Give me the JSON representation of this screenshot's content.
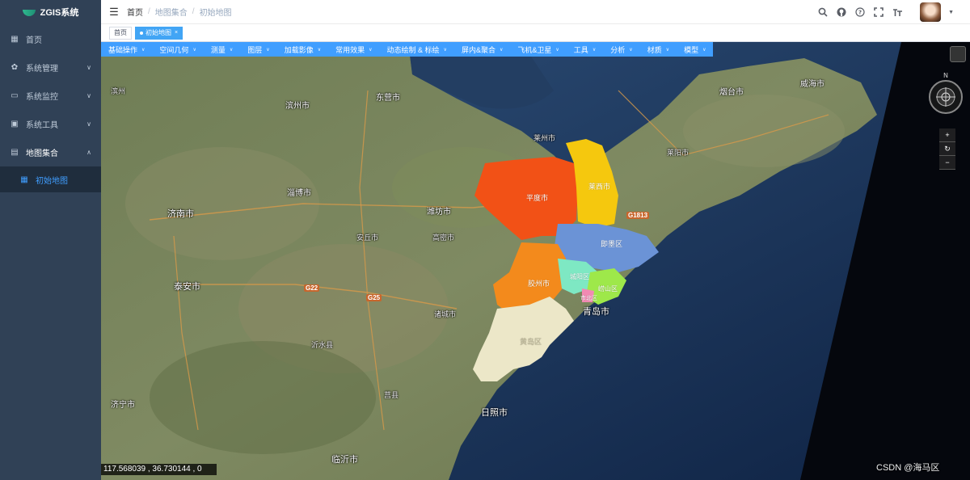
{
  "app": {
    "title": "ZGIS系统",
    "brand_color": "#304156",
    "accent_color": "#409eff"
  },
  "sidebar": {
    "items": [
      {
        "label": "首页",
        "icon": "dashboard-icon"
      },
      {
        "label": "系统管理",
        "icon": "gear-icon"
      },
      {
        "label": "系统监控",
        "icon": "monitor-icon"
      },
      {
        "label": "系统工具",
        "icon": "toolbox-icon"
      },
      {
        "label": "地图集合",
        "icon": "map-folder-icon",
        "expanded": true
      }
    ],
    "sub_items": [
      {
        "label": "初始地图",
        "icon": "grid-icon",
        "active": true
      }
    ]
  },
  "header": {
    "breadcrumb": [
      "首页",
      "地图集合",
      "初始地图"
    ],
    "icons": [
      "search-icon",
      "github-icon",
      "help-icon",
      "fullscreen-icon",
      "font-size-icon"
    ]
  },
  "tags": [
    {
      "label": "首页",
      "active": false
    },
    {
      "label": "初始地图",
      "active": true,
      "close": "×"
    }
  ],
  "toolbar": {
    "buttons": [
      "基础操作",
      "空间几何",
      "测量",
      "图层",
      "加载影像",
      "常用效果",
      "动态绘制 & 标绘",
      "屏内&聚合",
      "飞机&卫星",
      "工具",
      "分析",
      "材质",
      "模型"
    ]
  },
  "map": {
    "cities": [
      "滨州市",
      "东营市",
      "淄博市",
      "潍坊市",
      "济南市",
      "泰安市",
      "日照市",
      "临沂市",
      "济宁市",
      "烟台市",
      "威海市",
      "青岛市",
      "滨州",
      "莱州市",
      "莱阳市",
      "高密市",
      "安丘市",
      "诸城市",
      "沂水县",
      "莒县"
    ],
    "regions": [
      {
        "name": "平度市",
        "color": "#f25116"
      },
      {
        "name": "莱西市",
        "color": "#f5c80e"
      },
      {
        "name": "即墨区",
        "color": "#6b93d6"
      },
      {
        "name": "胶州市",
        "color": "#f38a1c"
      },
      {
        "name": "城阳区",
        "color": "#7ee8c3"
      },
      {
        "name": "崂山区",
        "color": "#9ee84a"
      },
      {
        "name": "市北区",
        "color": "#f28ab3"
      },
      {
        "name": "黄岛区",
        "color": "#ece7c8"
      }
    ],
    "roads": [
      "G1813",
      "G22",
      "G25"
    ],
    "zoom_buttons": [
      "+",
      "↻",
      "−"
    ],
    "compass_label": "N"
  },
  "status": {
    "coordinates": "117.568039 ,  36.730144 ,  0"
  },
  "watermark": "CSDN @海马区"
}
